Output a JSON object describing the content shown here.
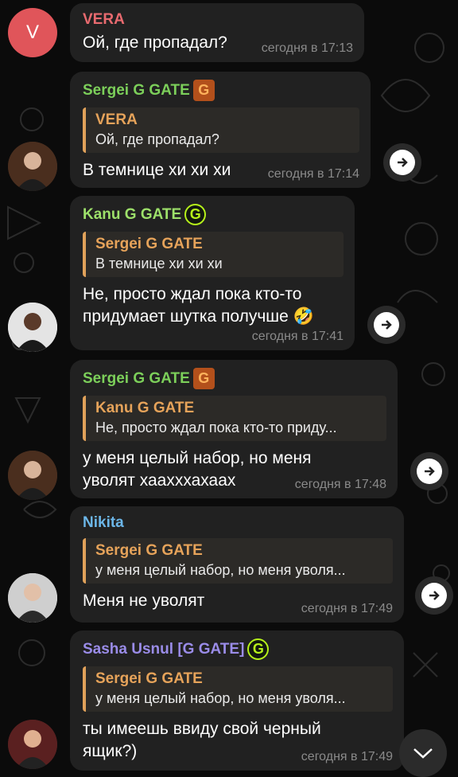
{
  "messages": [
    {
      "sender": "VERA",
      "sender_color": "#e86a6f",
      "avatar_letter": "V",
      "text": "Ой, где пропадал?",
      "time": "сегодня в 17:13"
    },
    {
      "sender": "Sergei G GATE",
      "sender_color": "#7ccf5a",
      "badge_icon": "orange-g-badge-icon",
      "reply": {
        "name": "VERA",
        "text": "Ой, где пропадал?"
      },
      "text": "В темнице хи хи хи",
      "time": "сегодня в 17:14"
    },
    {
      "sender": "Kanu G GATE",
      "sender_color": "#9de06a",
      "badge_icon": "green-g-gate-badge-icon",
      "reply": {
        "name": "Sergei G GATE",
        "text": "В темнице хи хи хи"
      },
      "text": "Не, просто ждал пока кто-то придумает шутка получше 🤣",
      "time": "сегодня в 17:41"
    },
    {
      "sender": "Sergei G GATE",
      "sender_color": "#7ccf5a",
      "badge_icon": "orange-g-badge-icon",
      "reply": {
        "name": "Kanu G GATE",
        "text": "Не, просто ждал пока кто-то приду..."
      },
      "text": "у меня целый набор, но меня уволят хаахххахаах",
      "time": "сегодня в 17:48"
    },
    {
      "sender": "Nikita",
      "sender_color": "#6cb6e8",
      "reply": {
        "name": "Sergei G GATE",
        "text": "у меня целый набор, но меня уволя..."
      },
      "text": "Меня не уволят",
      "time": "сегодня в 17:49"
    },
    {
      "sender": "Sasha Usnul [G GATE]",
      "sender_color": "#9a8ce8",
      "badge_icon": "green-g-gate-badge-icon",
      "reply": {
        "name": "Sergei G GATE",
        "text": "у меня целый набор, но меня уволя..."
      },
      "text": "ты имеешь ввиду свой черный ящик?)",
      "time": "сегодня в 17:49"
    }
  ],
  "badges": {
    "orange_letter": "G",
    "green_letter": "G"
  },
  "icons": {
    "forward": "forward-arrow-icon",
    "scroll_down": "chevron-down-icon"
  },
  "colors": {
    "bubble": "#212121",
    "reply_accent": "#e0a15a",
    "background": "#0b0b0b"
  }
}
